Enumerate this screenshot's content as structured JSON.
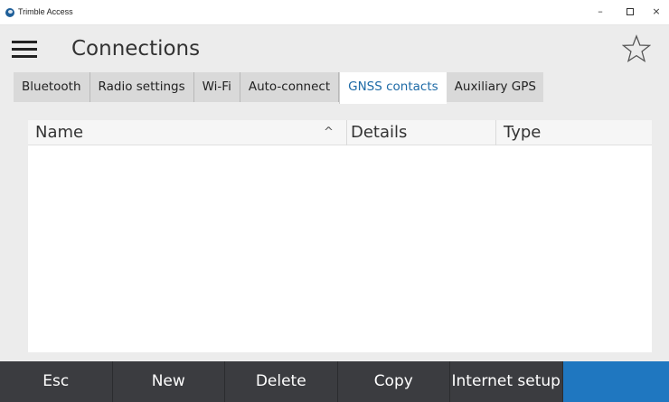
{
  "window": {
    "title": "Trimble Access",
    "controls": {
      "minimize": "–",
      "close": "×"
    }
  },
  "header": {
    "title": "Connections"
  },
  "tabs": [
    {
      "label": "Bluetooth",
      "active": false
    },
    {
      "label": "Radio settings",
      "active": false
    },
    {
      "label": "Wi-Fi",
      "active": false
    },
    {
      "label": "Auto-connect",
      "active": false
    },
    {
      "label": "GNSS contacts",
      "active": true
    },
    {
      "label": "Auxiliary GPS",
      "active": false
    }
  ],
  "table": {
    "columns": [
      "Name",
      "Details",
      "Type"
    ],
    "sort_indicator": "^",
    "rows": []
  },
  "softkeys": [
    {
      "label": "Esc"
    },
    {
      "label": "New"
    },
    {
      "label": "Delete"
    },
    {
      "label": "Copy"
    },
    {
      "label": "Internet setup"
    },
    {
      "label": ""
    }
  ],
  "colors": {
    "accent": "#1f77c0",
    "active_tab_text": "#1d6aa6",
    "softkey_bar": "#3b3c40"
  }
}
